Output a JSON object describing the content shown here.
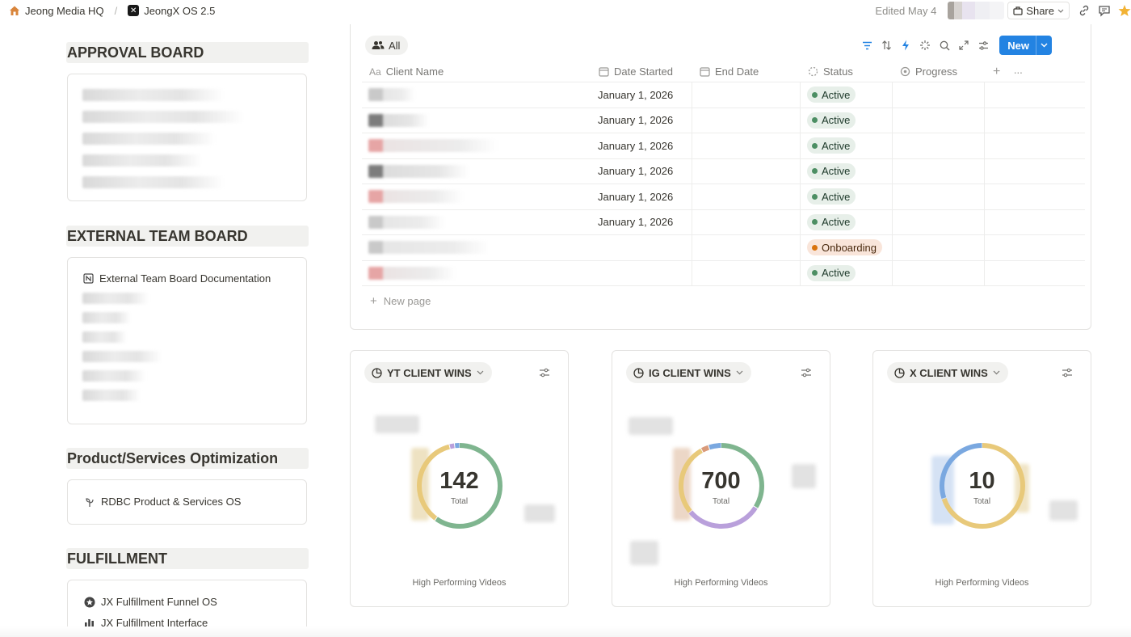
{
  "topbar": {
    "breadcrumb": [
      {
        "label": "Jeong Media HQ",
        "icon": "home-icon"
      },
      {
        "label": "JeongX OS 2.5",
        "icon": "os-icon"
      }
    ],
    "separator": "/",
    "edited": "Edited May 4",
    "share_label": "Share"
  },
  "left": {
    "approval": {
      "heading": "APPROVAL BOARD"
    },
    "external": {
      "heading": "EXTERNAL TEAM BOARD",
      "doc_label": "External Team Board Documentation"
    },
    "product": {
      "heading": "Product/Services Optimization",
      "item_label": "RDBC Product & Services OS"
    },
    "fulfillment": {
      "heading": "FULFILLMENT",
      "items": [
        "JX Fulfillment Funnel OS",
        "JX Fulfillment Interface"
      ]
    }
  },
  "table": {
    "view_tab": "All",
    "new_label": "New",
    "columns": [
      "Client Name",
      "Date Started",
      "End Date",
      "Status",
      "Progress"
    ],
    "rows": [
      {
        "date": "January 1, 2026",
        "status": "Active"
      },
      {
        "date": "January 1, 2026",
        "status": "Active"
      },
      {
        "date": "January 1, 2026",
        "status": "Active"
      },
      {
        "date": "January 1, 2026",
        "status": "Active"
      },
      {
        "date": "January 1, 2026",
        "status": "Active"
      },
      {
        "date": "January 1, 2026",
        "status": "Active"
      },
      {
        "date": "",
        "status": "Onboarding"
      },
      {
        "date": "",
        "status": "Active"
      }
    ],
    "new_page": "New page",
    "status_colors": {
      "Active": "#4c8e63",
      "Onboarding": "#d9730d"
    }
  },
  "charts": [
    {
      "title": "YT CLIENT WINS",
      "total": "142",
      "total_label": "Total",
      "caption": "High Performing Videos"
    },
    {
      "title": "IG CLIENT WINS",
      "total": "700",
      "total_label": "Total",
      "caption": "High Performing Videos"
    },
    {
      "title": "X CLIENT WINS",
      "total": "10",
      "total_label": "Total",
      "caption": "High Performing Videos"
    }
  ],
  "chart_data": [
    {
      "type": "pie",
      "title": "YT CLIENT WINS",
      "total": 142,
      "slices": [
        {
          "color": "#7fb58f",
          "fraction": 0.6
        },
        {
          "color": "#e8c97a",
          "fraction": 0.36
        },
        {
          "color": "#b9a0db",
          "fraction": 0.02
        },
        {
          "color": "#7aa8e0",
          "fraction": 0.02
        }
      ]
    },
    {
      "type": "pie",
      "title": "IG CLIENT WINS",
      "total": 700,
      "slices": [
        {
          "color": "#7fb58f",
          "fraction": 0.34
        },
        {
          "color": "#b9a0db",
          "fraction": 0.3
        },
        {
          "color": "#e8c97a",
          "fraction": 0.28
        },
        {
          "color": "#d99a7a",
          "fraction": 0.03
        },
        {
          "color": "#7aa8e0",
          "fraction": 0.05
        }
      ]
    },
    {
      "type": "pie",
      "title": "X CLIENT WINS",
      "total": 10,
      "slices": [
        {
          "color": "#e8c97a",
          "fraction": 0.7
        },
        {
          "color": "#7aa8e0",
          "fraction": 0.3
        }
      ]
    }
  ]
}
